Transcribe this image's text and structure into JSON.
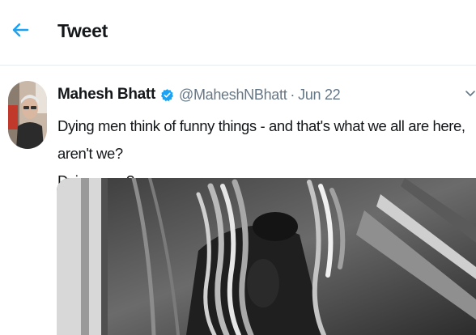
{
  "header": {
    "title": "Tweet",
    "back_icon": "back-arrow-icon",
    "accent": "#1da1f2"
  },
  "tweet": {
    "author_name": "Mahesh Bhatt",
    "verified": true,
    "handle": "@MaheshNBhatt",
    "separator": "·",
    "date": "Jun 22",
    "text": "Dying men think of funny things - and that's what we all are here, aren't we?\nDying men?",
    "menu_icon": "chevron-down-icon",
    "media_icon": "tweet-photo"
  },
  "colors": {
    "text": "#14171a",
    "secondary": "#657786",
    "divider": "#e6ecf0",
    "verified": "#1da1f2"
  }
}
